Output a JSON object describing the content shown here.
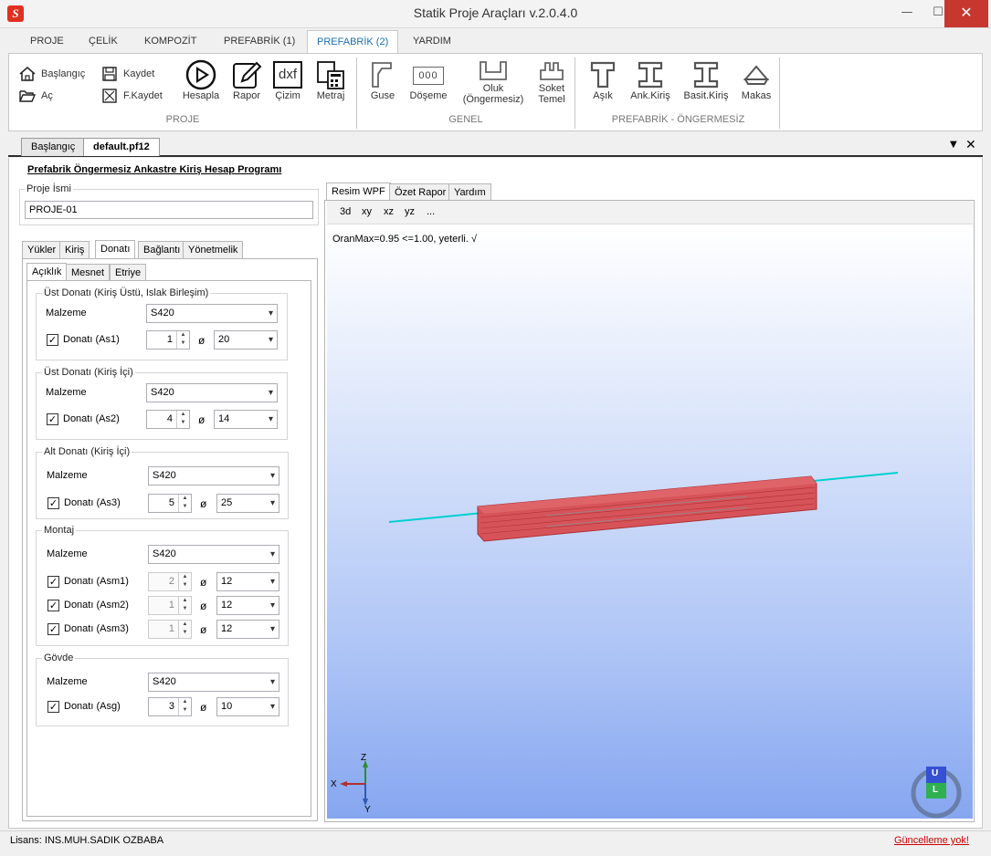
{
  "window": {
    "title": "Statik Proje Araçları v.2.0.4.0",
    "min": "—",
    "max": "☐",
    "close": "✕"
  },
  "ribbon_tabs": [
    "PROJE",
    "ÇELİK",
    "KOMPOZİT",
    "PREFABRİK (1)",
    "PREFABRİK (2)",
    "YARDIM"
  ],
  "ribbon": {
    "proje": {
      "label": "PROJE",
      "baslangic": "Başlangıç",
      "ac": "Aç",
      "kaydet": "Kaydet",
      "fkaydet": "F.Kaydet",
      "hesapla": "Hesapla",
      "rapor": "Rapor",
      "cizim": "Çizim",
      "metraj": "Metraj",
      "dxf": "dxf"
    },
    "genel": {
      "label": "GENEL",
      "guse": "Guse",
      "doseme": "Döşeme",
      "oluk": "Oluk",
      "oluk2": "(Öngermesiz)",
      "soket": "Soket",
      "soket2": "Temel",
      "doseme_icon": "000"
    },
    "prefabrik": {
      "label": "PREFABRİK - ÖNGERMESİZ",
      "asik": "Aşık",
      "ankkiris": "Ank.Kiriş",
      "basitkiris": "Basit.Kiriş",
      "makas": "Makas"
    }
  },
  "doc_tabs": [
    "Başlangıç",
    "default.pf12"
  ],
  "doc_controls": {
    "down": "▼",
    "close": "✕"
  },
  "program_title": "Prefabrik Öngermesiz Ankastre Kiriş Hesap Programı",
  "proje_isim": {
    "label": "Proje İsmi",
    "value": "PROJE-01"
  },
  "main_tabs": [
    "Yükler",
    "Kiriş",
    "Donatı",
    "Bağlantı",
    "Yönetmelik"
  ],
  "sub_tabs": [
    "Açıklık",
    "Mesnet",
    "Etriye"
  ],
  "sections": {
    "ust1": {
      "title": "Üst Donatı (Kiriş Üstü, Islak Birleşim)",
      "malzeme_label": "Malzeme",
      "malzeme": "S420",
      "donati_label": "Donatı (As1)",
      "count": "1",
      "dia": "20"
    },
    "ust2": {
      "title": "Üst Donatı (Kiriş İçi)",
      "malzeme_label": "Malzeme",
      "malzeme": "S420",
      "donati_label": "Donatı (As2)",
      "count": "4",
      "dia": "14"
    },
    "alt": {
      "title": "Alt Donatı (Kiriş İçi)",
      "malzeme_label": "Malzeme",
      "malzeme": "S420",
      "donati_label": "Donatı (As3)",
      "count": "5",
      "dia": "25"
    },
    "montaj": {
      "title": "Montaj",
      "malzeme_label": "Malzeme",
      "malzeme": "S420",
      "rows": [
        {
          "label": "Donatı (Asm1)",
          "count": "2",
          "dia": "12"
        },
        {
          "label": "Donatı (Asm2)",
          "count": "1",
          "dia": "12"
        },
        {
          "label": "Donatı (Asm3)",
          "count": "1",
          "dia": "12"
        }
      ]
    },
    "govde": {
      "title": "Gövde",
      "malzeme_label": "Malzeme",
      "malzeme": "S420",
      "donati_label": "Donatı (Asg)",
      "count": "3",
      "dia": "10"
    }
  },
  "symbols": {
    "phi": "ø",
    "check": "✓",
    "dropdown": "▾",
    "spin_up": "▲",
    "spin_down": "▼"
  },
  "viewer": {
    "tabs": [
      "Resim WPF",
      "Özet Rapor",
      "Yardım"
    ],
    "toolbar": [
      "3d",
      "xy",
      "xz",
      "yz",
      "..."
    ],
    "result": "OranMax=0.95 <=1.00, yeterli. √",
    "axes": {
      "x": "X",
      "y": "Y",
      "z": "Z"
    },
    "cube_labels": {
      "top": "U",
      "front": "L"
    }
  },
  "status": {
    "license": "Lisans: INS.MUH.SADIK OZBABA",
    "update": "Güncelleme yok!"
  },
  "colors": {
    "accent": "#1a6fb3",
    "beam": "#d9484d",
    "rebar": "#00d0d0",
    "close": "#c7372f",
    "update": "#d00000"
  }
}
